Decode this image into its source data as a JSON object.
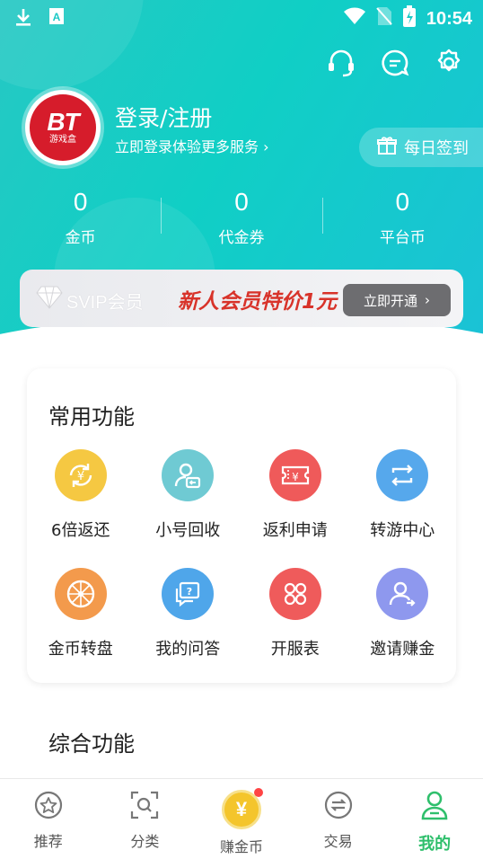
{
  "status_bar": {
    "time": "10:54"
  },
  "profile": {
    "avatar_logo_text": "BT",
    "avatar_logo_sub": "游戏盒",
    "title": "登录/注册",
    "subtitle": "立即登录体验更多服务",
    "checkin_label": "每日签到"
  },
  "stats": [
    {
      "value": "0",
      "label": "金币"
    },
    {
      "value": "0",
      "label": "代金券"
    },
    {
      "value": "0",
      "label": "平台币"
    }
  ],
  "svip": {
    "label": "SVIP会员",
    "promo": "新人会员特价1元",
    "button": "立即开通"
  },
  "common_functions": {
    "title": "常用功能",
    "items": [
      {
        "label": "6倍返还",
        "icon": "yuan-refresh-icon",
        "color": "#f5c842"
      },
      {
        "label": "小号回收",
        "icon": "account-recycle-icon",
        "color": "#6fcad3"
      },
      {
        "label": "返利申请",
        "icon": "rebate-ticket-icon",
        "color": "#ef5a5a"
      },
      {
        "label": "转游中心",
        "icon": "transfer-icon",
        "color": "#56a8ec"
      },
      {
        "label": "金币转盘",
        "icon": "wheel-icon",
        "color": "#f39a4c"
      },
      {
        "label": "我的问答",
        "icon": "qa-icon",
        "color": "#4fa6ea"
      },
      {
        "label": "开服表",
        "icon": "server-list-icon",
        "color": "#ef5b5b"
      },
      {
        "label": "邀请赚金",
        "icon": "invite-icon",
        "color": "#8e98ee"
      }
    ]
  },
  "general_functions": {
    "title": "综合功能"
  },
  "tabbar": [
    {
      "label": "推荐",
      "icon": "star-circle-icon",
      "active": false
    },
    {
      "label": "分类",
      "icon": "search-box-icon",
      "active": false
    },
    {
      "label": "赚金币",
      "icon": "coin-icon",
      "active": false
    },
    {
      "label": "交易",
      "icon": "exchange-icon",
      "active": false
    },
    {
      "label": "我的",
      "icon": "user-icon",
      "active": true
    }
  ],
  "colors": {
    "header": "#1ccbc8",
    "active_tab": "#2fbf6c",
    "promo": "#d8332a"
  }
}
